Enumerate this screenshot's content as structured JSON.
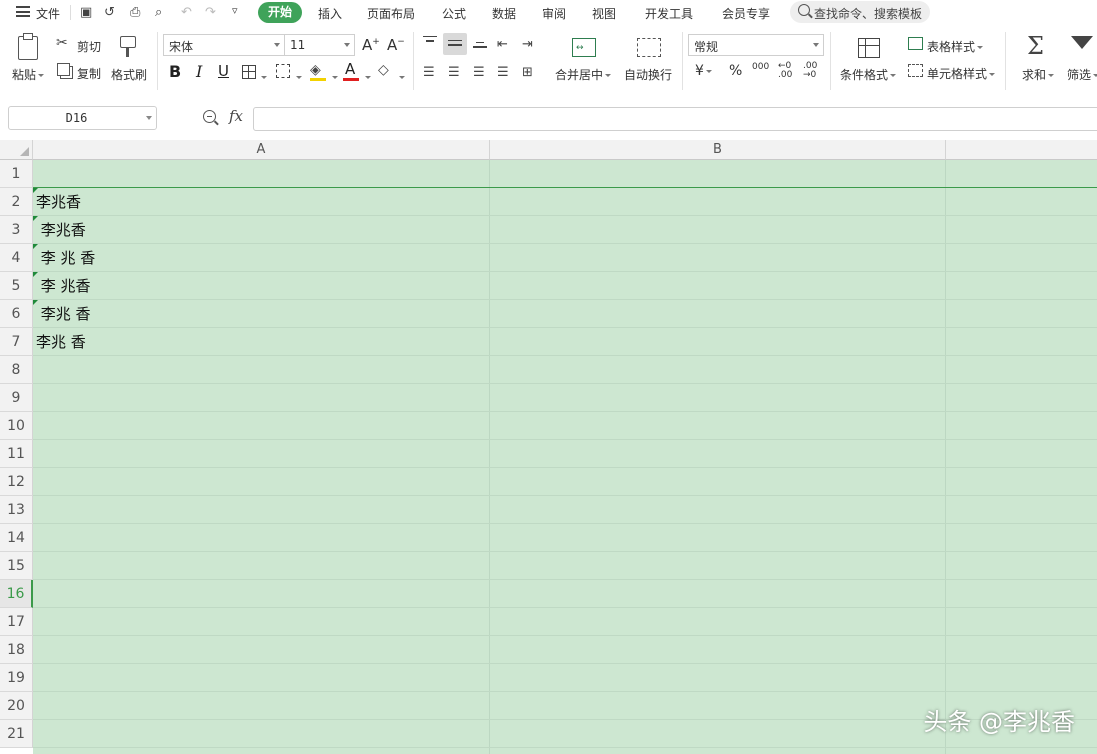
{
  "menubar": {
    "file_label": "文件",
    "tabs": [
      "开始",
      "插入",
      "页面布局",
      "公式",
      "数据",
      "审阅",
      "视图",
      "开发工具",
      "会员专享"
    ],
    "search_label": "查找命令、搜索模板"
  },
  "ribbon": {
    "paste": "粘贴",
    "cut": "剪切",
    "copy": "复制",
    "format_painter": "格式刷",
    "font_name": "宋体",
    "font_size": "11",
    "merge_center": "合并居中",
    "wrap_text": "自动换行",
    "number_format": "常规",
    "conditional_format": "条件格式",
    "table_style": "表格样式",
    "cell_style": "单元格样式",
    "sum": "求和",
    "filter": "筛选",
    "bold": "B",
    "italic": "I",
    "underline": "U",
    "font_color_glyph": "A",
    "currency": "¥",
    "percent": "%",
    "thousands": "000"
  },
  "formula_bar": {
    "name_box": "D16",
    "fx": "fx",
    "formula": ""
  },
  "grid": {
    "columns": [
      "A",
      "B"
    ],
    "rows": [
      {
        "num": "1",
        "a": ""
      },
      {
        "num": "2",
        "a": "李兆香"
      },
      {
        "num": "3",
        "a": " 李兆香"
      },
      {
        "num": "4",
        "a": " 李 兆 香"
      },
      {
        "num": "5",
        "a": " 李 兆香"
      },
      {
        "num": "6",
        "a": " 李兆 香"
      },
      {
        "num": "7",
        "a": "李兆 香"
      },
      {
        "num": "8",
        "a": ""
      },
      {
        "num": "9",
        "a": ""
      },
      {
        "num": "10",
        "a": ""
      },
      {
        "num": "11",
        "a": ""
      },
      {
        "num": "12",
        "a": ""
      },
      {
        "num": "13",
        "a": ""
      },
      {
        "num": "14",
        "a": ""
      },
      {
        "num": "15",
        "a": ""
      },
      {
        "num": "16",
        "a": ""
      },
      {
        "num": "17",
        "a": ""
      },
      {
        "num": "18",
        "a": ""
      },
      {
        "num": "19",
        "a": ""
      },
      {
        "num": "20",
        "a": ""
      },
      {
        "num": "21",
        "a": ""
      }
    ],
    "active_row": "16",
    "green_flag_rows": [
      "2",
      "3",
      "4",
      "5",
      "6"
    ]
  },
  "colors": {
    "accent": "#3fa35a",
    "selection_fill": "#cde7d1"
  },
  "watermark": "头条 @李兆香"
}
